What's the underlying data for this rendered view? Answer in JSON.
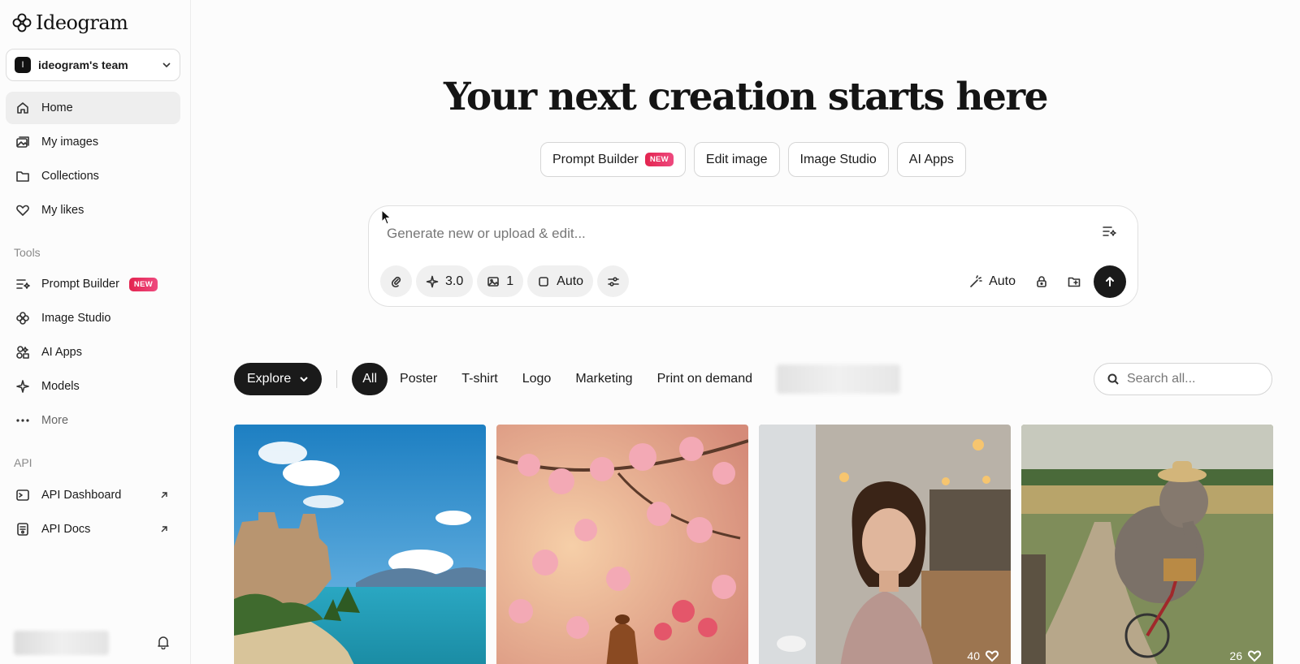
{
  "app": {
    "brand": "Ideogram",
    "team": {
      "initial": "I",
      "name": "ideogram's team"
    }
  },
  "sidebar": {
    "main_items": [
      {
        "label": "Home",
        "icon": "home-icon",
        "active": true
      },
      {
        "label": "My images",
        "icon": "images-icon"
      },
      {
        "label": "Collections",
        "icon": "folder-icon"
      },
      {
        "label": "My likes",
        "icon": "heart-icon"
      }
    ],
    "tools_label": "Tools",
    "tools_items": [
      {
        "label": "Prompt Builder",
        "icon": "prompt-builder-icon",
        "badge": "NEW"
      },
      {
        "label": "Image Studio",
        "icon": "image-studio-icon"
      },
      {
        "label": "AI Apps",
        "icon": "ai-apps-icon"
      },
      {
        "label": "Models",
        "icon": "sparkle-icon"
      },
      {
        "label": "More",
        "icon": "more-dots-icon"
      }
    ],
    "api_label": "API",
    "api_items": [
      {
        "label": "API Dashboard",
        "icon": "terminal-icon"
      },
      {
        "label": "API Docs",
        "icon": "docs-icon"
      }
    ]
  },
  "main": {
    "headline": "Your next creation starts here",
    "quick_actions": [
      {
        "label": "Prompt Builder",
        "badge": "NEW"
      },
      {
        "label": "Edit image"
      },
      {
        "label": "Image Studio"
      },
      {
        "label": "AI Apps"
      }
    ],
    "prompt": {
      "placeholder": "Generate new or upload & edit...",
      "model": "3.0",
      "image_count": "1",
      "aspect": "Auto",
      "magic_prompt": "Auto"
    },
    "filters": {
      "explore_label": "Explore",
      "categories": [
        "All",
        "Poster",
        "T-shirt",
        "Logo",
        "Marketing",
        "Print on demand"
      ],
      "active_category": "All",
      "search_placeholder": "Search all..."
    },
    "gallery": [
      {
        "subject": "castle-by-sea",
        "likes": null
      },
      {
        "subject": "cherry-blossoms",
        "likes": null
      },
      {
        "subject": "woman-in-cafe",
        "likes": "40"
      },
      {
        "subject": "elephant-on-bicycle",
        "likes": "26"
      }
    ]
  },
  "colors": {
    "accent_dark": "#1a1a1a",
    "badge_gradient_start": "#e3244f",
    "badge_gradient_end": "#ee4a7f",
    "active_nav_bg": "#eeeeee"
  }
}
